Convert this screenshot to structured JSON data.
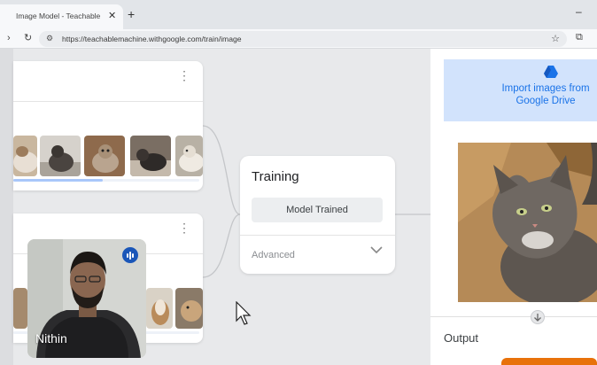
{
  "browser": {
    "tab_title": "Image Model - Teachable Machine",
    "tab_close_icon": "close-icon",
    "new_tab_label": "+",
    "minimize_label": "–",
    "url": "https://teachablemachine.withgoogle.com/train/image"
  },
  "training": {
    "title": "Training",
    "status_button": "Model Trained",
    "advanced_label": "Advanced"
  },
  "right_panel": {
    "import_label": "Import images from Google Drive",
    "output_label": "Output"
  },
  "webcam": {
    "participant_name": "Nithin"
  },
  "colors": {
    "accent_blue": "#1a73e8",
    "import_bg": "#d2e3fc",
    "export_orange": "#e8710a",
    "progress_blue": "#a8c7fa"
  },
  "progress": {
    "class_1_fraction": 0.48
  }
}
